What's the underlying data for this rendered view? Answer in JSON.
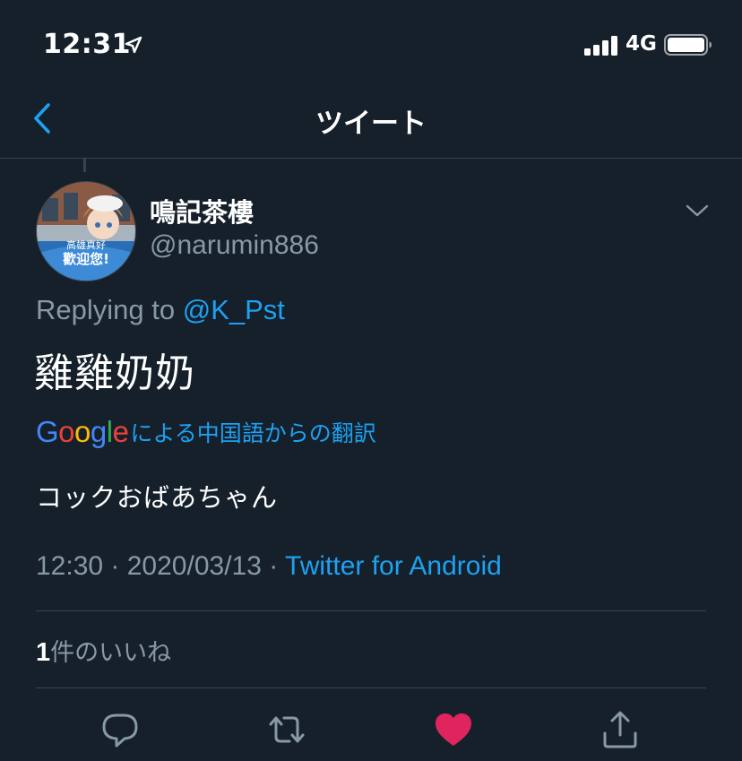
{
  "status_bar": {
    "time": "12:31",
    "network": "4G"
  },
  "nav": {
    "title": "ツイート"
  },
  "tweet": {
    "display_name": "鳴記茶樓",
    "handle": "@narumin886",
    "avatar_caption_1": "高雄真好",
    "avatar_caption_2": "歡迎您!",
    "replying_prefix": "Replying to ",
    "replying_to": "@K_Pst",
    "text": "雞雞奶奶",
    "translation": {
      "logo": {
        "G": "G",
        "o1": "o",
        "o2": "o",
        "g": "g",
        "l": "l",
        "e": "e"
      },
      "label": "による中国語からの翻訳",
      "text": "コックおばあちゃん"
    },
    "time": "12:30",
    "separator": " · ",
    "date": "2020/03/13",
    "source": "Twitter for Android",
    "likes_count": "1",
    "likes_label": "件のいいね"
  },
  "icons": {
    "back": "chevron-left-icon",
    "more": "chevron-down-icon",
    "reply": "speech-bubble-icon",
    "retweet": "retweet-arrows-icon",
    "like": "heart-icon",
    "share": "share-upload-icon"
  },
  "colors": {
    "background": "#15202b",
    "accent": "#1da1f2",
    "secondary_text": "#8899a6",
    "divider": "#38444d",
    "like": "#e0245e",
    "google_blue": "#4285f4",
    "google_red": "#ea4335",
    "google_yellow": "#fbbc05",
    "google_green": "#34a853"
  }
}
